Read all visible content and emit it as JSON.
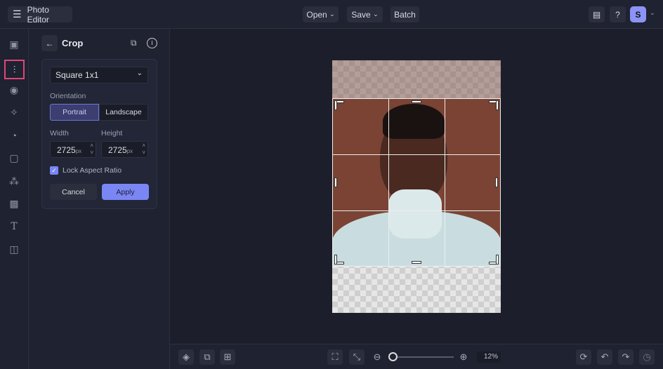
{
  "app": {
    "title": "Photo Editor",
    "menu": [
      "Open",
      "Save",
      "Batch"
    ],
    "avatar": "S"
  },
  "panel": {
    "title": "Crop",
    "preset": "Square 1x1",
    "orientation_label": "Orientation",
    "orientations": [
      "Portrait",
      "Landscape"
    ],
    "selected_orientation": "Portrait",
    "width_label": "Width",
    "height_label": "Height",
    "width": "2725",
    "height": "2725",
    "unit": "px",
    "lock_label": "Lock Aspect Ratio",
    "lock_checked": true,
    "cancel": "Cancel",
    "apply": "Apply"
  },
  "zoom": {
    "value": "12%",
    "fraction": 0.02
  },
  "colors": {
    "accent": "#7b86f5",
    "highlight": "#e0457b"
  }
}
